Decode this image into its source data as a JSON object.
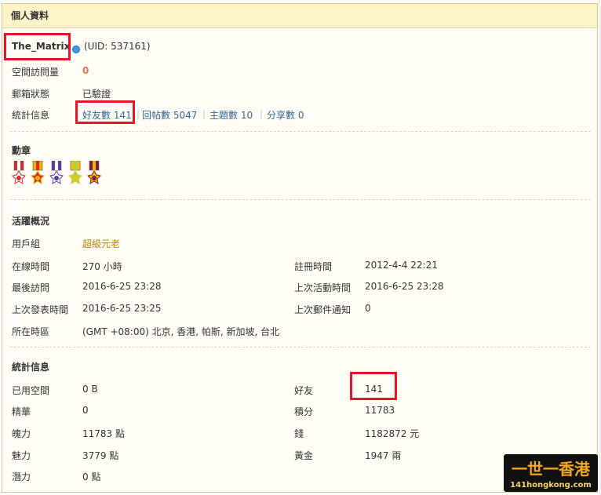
{
  "header": {
    "title": "個人資料"
  },
  "profile": {
    "username": "The_Matrix",
    "uid_text": "(UID: 537161)",
    "space_visits_label": "空間訪問量",
    "space_visits_value": "0",
    "email_label": "郵箱狀態",
    "email_value": "已驗證",
    "stats_label": "統計信息",
    "stats_links": [
      {
        "label": "好友數 141"
      },
      {
        "label": "回帖數 5047"
      },
      {
        "label": "主題數 10"
      },
      {
        "label": "分享數 0"
      }
    ]
  },
  "medals": {
    "title": "勳章",
    "items": [
      {
        "icon": "medal-icon-1",
        "colors": [
          "#d62c2c",
          "#ffffff"
        ]
      },
      {
        "icon": "medal-icon-2",
        "colors": [
          "#e8b400",
          "#d62c2c"
        ]
      },
      {
        "icon": "medal-icon-3",
        "colors": [
          "#5a3c9b",
          "#ffffff"
        ]
      },
      {
        "icon": "medal-icon-4",
        "colors": [
          "#f1c40f",
          "#a8d34a"
        ]
      },
      {
        "icon": "medal-icon-5",
        "colors": [
          "#7a1f3d",
          "#f4b400"
        ]
      }
    ]
  },
  "activity": {
    "title": "活躍概況",
    "usergroup_label": "用戶組",
    "usergroup_value": "超級元老",
    "left": [
      {
        "label": "在線時間",
        "value": "270 小時"
      },
      {
        "label": "最後訪問",
        "value": "2016-6-25 23:28"
      },
      {
        "label": "上次發表時間",
        "value": "2016-6-25 23:25"
      },
      {
        "label": "所在時區",
        "value": "(GMT +08:00) 北京, 香港, 帕斯, 新加坡, 台北"
      }
    ],
    "right": [
      {
        "label": "註冊時間",
        "value": "2012-4-4 22:21"
      },
      {
        "label": "上次活動時間",
        "value": "2016-6-25 23:28"
      },
      {
        "label": "上次郵件通知",
        "value": "0"
      }
    ]
  },
  "statistics": {
    "title": "統計信息",
    "left": [
      {
        "label": "已用空間",
        "value": "0 B"
      },
      {
        "label": "精華",
        "value": "0"
      },
      {
        "label": "魄力",
        "value": "11783 點"
      },
      {
        "label": "魅力",
        "value": "3779 點"
      },
      {
        "label": "潛力",
        "value": "0 點"
      }
    ],
    "right": [
      {
        "label": "好友",
        "value": "141"
      },
      {
        "label": "積分",
        "value": "11783"
      },
      {
        "label": "錢",
        "value": "1182872 元"
      },
      {
        "label": "黃金",
        "value": "1947 兩"
      }
    ]
  },
  "watermark": {
    "line1": "一世一香港",
    "line2": "141hongkong.com"
  },
  "colors": {
    "accent_red": "#e5162a",
    "header_bg": "#fdf3c9",
    "link": "#336699",
    "orange": "#f26c4f",
    "gold": "#b38600"
  }
}
